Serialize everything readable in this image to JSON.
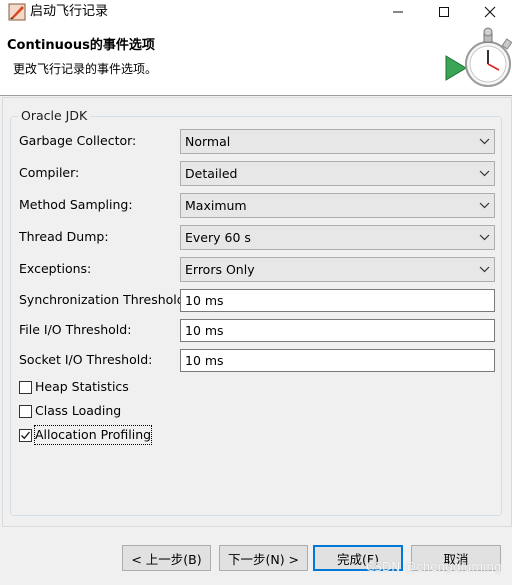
{
  "window": {
    "title": "启动飞行记录",
    "minimize_icon": "minimize-icon",
    "maximize_icon": "maximize-icon",
    "close_icon": "close-icon"
  },
  "header": {
    "title": "Continuous的事件选项",
    "subtitle": "更改飞行记录的事件选项。",
    "art_icon": "stopwatch-play-icon"
  },
  "group": {
    "label": "Oracle JDK"
  },
  "settings": [
    {
      "label": "Garbage Collector:",
      "value": "Normal"
    },
    {
      "label": "Compiler:",
      "value": "Detailed"
    },
    {
      "label": "Method Sampling:",
      "value": "Maximum"
    },
    {
      "label": "Thread Dump:",
      "value": "Every 60 s"
    },
    {
      "label": "Exceptions:",
      "value": "Errors Only"
    }
  ],
  "thresholds": [
    {
      "label": "Synchronization Threshold:",
      "value": "10 ms"
    },
    {
      "label": "File I/O Threshold:",
      "value": "10 ms"
    },
    {
      "label": "Socket I/O Threshold:",
      "value": "10 ms"
    }
  ],
  "checkboxes": [
    {
      "label": "Heap Statistics",
      "checked": false
    },
    {
      "label": "Class Loading",
      "checked": false
    },
    {
      "label": "Allocation Profiling",
      "checked": true
    }
  ],
  "buttons": {
    "back": "< 上一步(B)",
    "next": "下一步(N) >",
    "finish": "完成(F)",
    "cancel": "取消"
  },
  "watermark": "CSDN @chengqiuming",
  "colors": {
    "focus_accent": "#0078d7",
    "window_bg": "#f0f0f0"
  }
}
